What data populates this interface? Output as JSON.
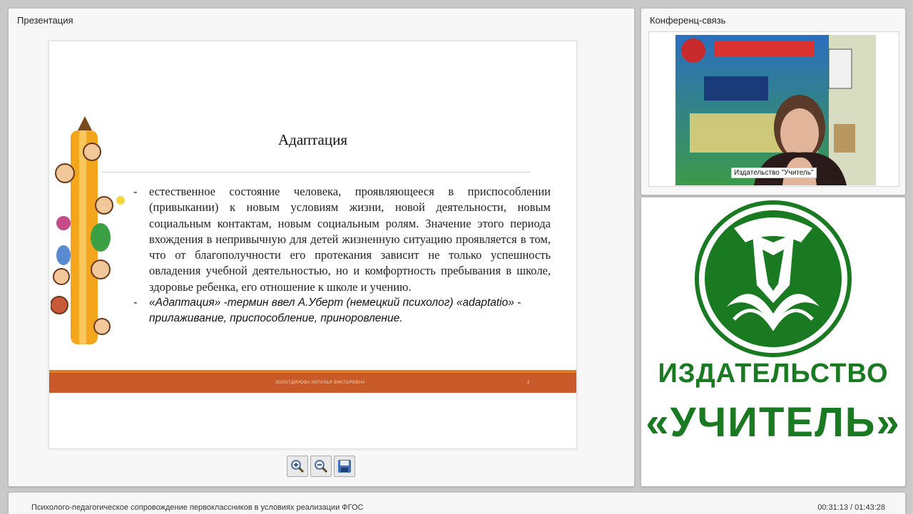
{
  "presentation": {
    "title": "Презентация",
    "slide": {
      "heading": "Адаптация",
      "bullets": [
        "естественное состояние человека, проявляющееся в приспособлении (привыкании) к новым условиям жизни, новой деятельности, новым социальным контактам, новым социальным ролям. Значение этого периода вхождения в непривычную для детей жизненную ситуацию проявляется в том, что от благополучности его протекания зависит не только успешность овладения учебной деятельностью, но и комфортность пребывания в школе, здоровье ребенка, его отношение к школе и учению.",
        "«Адаптация» -термин ввел А.Уберт (немецкий психолог) «adaptatio» - прилаживание, приспособление, приноровление."
      ],
      "bullet_marker": "-",
      "footer_text": "ЗОЛОТДИНОВА НАТАЛЬЯ ВИКТОРОВНА",
      "page_number": "2",
      "footer_color": "#c75a28",
      "footer_line_color": "#e07b1f"
    },
    "controls": [
      {
        "name": "zoom-in",
        "icon": "zoom-in-icon"
      },
      {
        "name": "zoom-out",
        "icon": "zoom-out-icon"
      },
      {
        "name": "save",
        "icon": "floppy-disk-icon"
      }
    ]
  },
  "conference": {
    "title": "Конференц-связь",
    "camera_label": "Издательство \"Учитель\""
  },
  "logo": {
    "publisher": "ИЗДАТЕЛЬСТВО",
    "brand": "«УЧИТЕЛЬ»",
    "color": "#1a7a22"
  },
  "footer": {
    "lesson_title": "Психолого-педагогическое сопровождение первоклассников в условиях реализации ФГОС",
    "time": "00:31:13 / 01:43:28"
  }
}
